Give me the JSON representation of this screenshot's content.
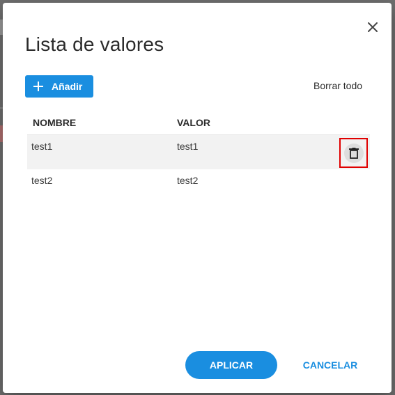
{
  "dialog": {
    "title": "Lista de valores",
    "close_icon": "close-icon",
    "add_label": "Añadir",
    "add_icon": "plus-icon",
    "clear_all_label": "Borrar todo",
    "apply_label": "APLICAR",
    "cancel_label": "CANCELAR"
  },
  "table": {
    "columns": [
      "NOMBRE",
      "VALOR"
    ],
    "rows": [
      {
        "name": "test1",
        "value": "test1"
      },
      {
        "name": "test2",
        "value": "test2"
      }
    ],
    "delete_icon": "trash-icon"
  },
  "colors": {
    "accent": "#1a8ee0",
    "highlight": "#e00000"
  }
}
